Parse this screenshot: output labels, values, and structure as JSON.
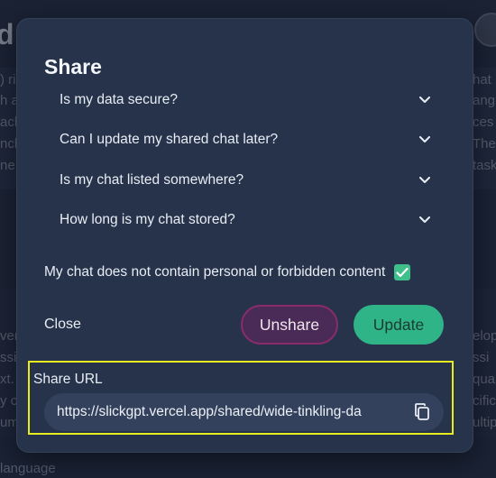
{
  "background": {
    "title_fragment": "d",
    "snippets_left": [
      ") ri",
      "h a",
      "ach",
      "nch",
      "ne"
    ],
    "snippets_right": [
      "hat",
      "ang",
      "ces",
      "The",
      "task"
    ],
    "snippets_left2": [
      "vers",
      "ssi",
      "xt.",
      "y c",
      "um"
    ],
    "snippets_right2": [
      "elop",
      "ssi",
      "qua",
      "cific",
      "ultip"
    ],
    "footer_fragment": "language"
  },
  "modal": {
    "title": "Share",
    "faq": [
      {
        "label": "Is my data secure?",
        "icon": "chevron-down-icon"
      },
      {
        "label": "Can I update my shared chat later?",
        "icon": "chevron-down-icon"
      },
      {
        "label": "Is my chat listed somewhere?",
        "icon": "chevron-down-icon"
      },
      {
        "label": "How long is my chat stored?",
        "icon": "chevron-down-icon"
      }
    ],
    "consent": {
      "label": "My chat does not contain personal or forbidden content",
      "checked": true
    },
    "buttons": {
      "close": "Close",
      "unshare": "Unshare",
      "update": "Update"
    },
    "share": {
      "label": "Share URL",
      "url": "https://slickgpt.vercel.app/shared/wide-tinkling-da",
      "copy_icon": "copy-icon"
    }
  },
  "colors": {
    "accent_green": "#2eb486",
    "unshare_bg": "#4a2a56",
    "unshare_border": "#8a2c6b",
    "highlight": "#e8ec1d"
  }
}
